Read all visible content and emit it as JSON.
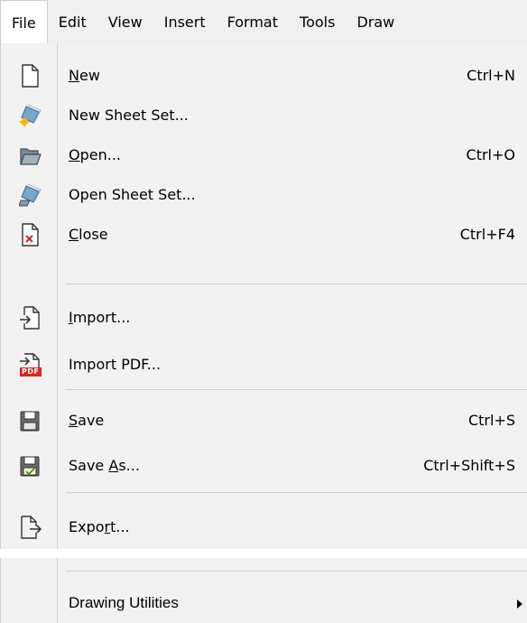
{
  "menubar": {
    "items": [
      "File",
      "Edit",
      "View",
      "Insert",
      "Format",
      "Tools",
      "Draw"
    ]
  },
  "file_menu": {
    "new": {
      "pre": "",
      "accel": "N",
      "post": "ew",
      "shortcut": "Ctrl+N",
      "icon": "new-document-icon"
    },
    "new_sheet_set": {
      "label": "New Sheet Set...",
      "icon": "new-sheet-set-icon"
    },
    "open": {
      "pre": "",
      "accel": "O",
      "post": "pen...",
      "shortcut": "Ctrl+O",
      "icon": "folder-open-icon"
    },
    "open_sheet_set": {
      "label": "Open Sheet Set...",
      "icon": "open-sheet-set-icon"
    },
    "close": {
      "pre": "",
      "accel": "C",
      "post": "lose",
      "shortcut": "Ctrl+F4",
      "icon": "close-document-icon"
    },
    "import": {
      "pre": "",
      "accel": "I",
      "post": "mport...",
      "icon": "import-icon"
    },
    "import_pdf": {
      "label": "Import PDF...",
      "icon": "import-pdf-icon",
      "badge": "PDF"
    },
    "save": {
      "pre": "",
      "accel": "S",
      "post": "ave",
      "shortcut": "Ctrl+S",
      "icon": "save-icon"
    },
    "save_as": {
      "pre": "Save ",
      "accel": "A",
      "post": "s...",
      "shortcut": "Ctrl+Shift+S",
      "icon": "save-as-icon"
    },
    "export": {
      "pre": "Expo",
      "accel": "r",
      "post": "t...",
      "icon": "export-icon"
    }
  },
  "lower_menu": {
    "drawing_utilities": {
      "label": "Drawing Utilities",
      "icon": "submenu-arrow-icon"
    }
  },
  "colors": {
    "menu_bg": "#f2f2f2",
    "separator": "#cfcfcf",
    "pdf_red": "#d9261c"
  }
}
